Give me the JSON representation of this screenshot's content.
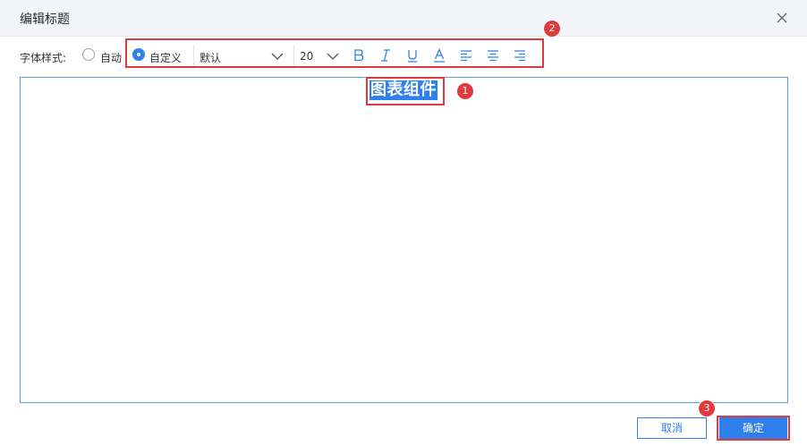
{
  "dialog": {
    "title": "编辑标题"
  },
  "font_style": {
    "label": "字体样式:",
    "options": [
      "自动",
      "自定义"
    ],
    "selected": "自定义",
    "font_family": "默认",
    "font_size": "20",
    "tools": [
      "bold-icon",
      "italic-icon",
      "underline-icon",
      "font-color-icon",
      "align-left-icon",
      "align-center-icon",
      "align-right-icon"
    ]
  },
  "editor": {
    "content": "图表组件"
  },
  "annotations": [
    "1",
    "2",
    "3"
  ],
  "buttons": {
    "cancel": "取消",
    "confirm": "确定"
  },
  "colors": {
    "accent": "#2f80ed",
    "highlight": "#e0393e",
    "header_bg": "#f3f5f8"
  }
}
